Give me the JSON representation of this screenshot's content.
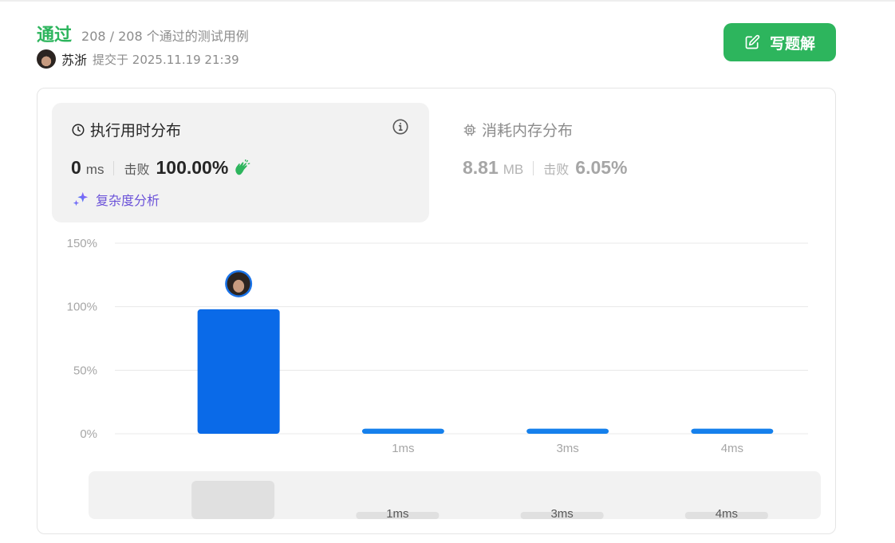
{
  "header": {
    "status": "通过",
    "cases_passed": "208 / 208 个通过的测试用例",
    "user_name": "苏浙",
    "submitted_at": "提交于 2025.11.19 21:39",
    "solution_button": "写题解"
  },
  "runtime": {
    "title": "执行用时分布",
    "value": "0",
    "unit": "ms",
    "beats_label": "击败",
    "beats_pct": "100.00%",
    "complexity_link": "复杂度分析"
  },
  "memory": {
    "title": "消耗内存分布",
    "value": "8.81",
    "unit": "MB",
    "beats_label": "击败",
    "beats_pct": "6.05%"
  },
  "colors": {
    "accepted": "#2db55d",
    "bar": "#0a6ae8",
    "bar_secondary": "#1580ec",
    "complexity": "#6b52d9"
  },
  "chart_data": {
    "type": "bar",
    "ylim": [
      0,
      150
    ],
    "yticks": [
      "0%",
      "50%",
      "100%",
      "150%"
    ],
    "categories": [
      "",
      "1ms",
      "3ms",
      "4ms"
    ],
    "values": [
      98,
      4,
      4,
      4
    ],
    "highlight_index": 0,
    "grid": true
  },
  "overview": {
    "categories": [
      "",
      "1ms",
      "3ms",
      "4ms"
    ]
  }
}
